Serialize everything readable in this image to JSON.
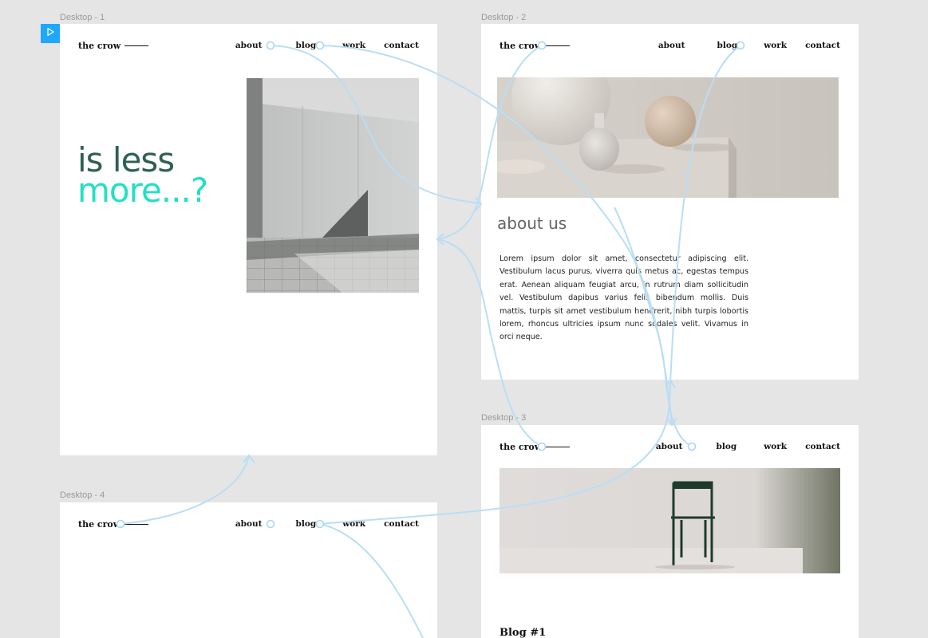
{
  "frames": {
    "d1": {
      "label": "Desktop - 1"
    },
    "d2": {
      "label": "Desktop - 2"
    },
    "d3": {
      "label": "Desktop - 3"
    },
    "d4": {
      "label": "Desktop - 4"
    }
  },
  "logo": "the crow",
  "nav": {
    "about": "about",
    "blog": "blog",
    "work": "work",
    "contact": "contact"
  },
  "d1": {
    "hero_line1": "is less",
    "hero_line2": "more...?"
  },
  "d2": {
    "heading": "about us",
    "body": "Lorem ipsum dolor sit amet, consectetur adipiscing elit. Vestibulum lacus purus, viverra quis metus ac, egestas tempus erat. Aenean aliquam feugiat arcu, in rutrum diam sollicitudin vel. Vestibulum dapibus varius felis bibendum mollis. Duis mattis, turpis sit amet vestibulum hendrerit, nibh turpis lobortis lorem, rhoncus ultricies ipsum nunc sodales velit. Vivamus in orci neque."
  },
  "d3": {
    "blog_title": "Blog #1"
  },
  "colors": {
    "canvas": "#e5e5e5",
    "accent": "#1ea7fd",
    "hero_dark": "#2f5f55",
    "hero_teal": "#22e0c4",
    "wire": "#bfe3f7"
  },
  "icons": {
    "play": "play-icon"
  }
}
